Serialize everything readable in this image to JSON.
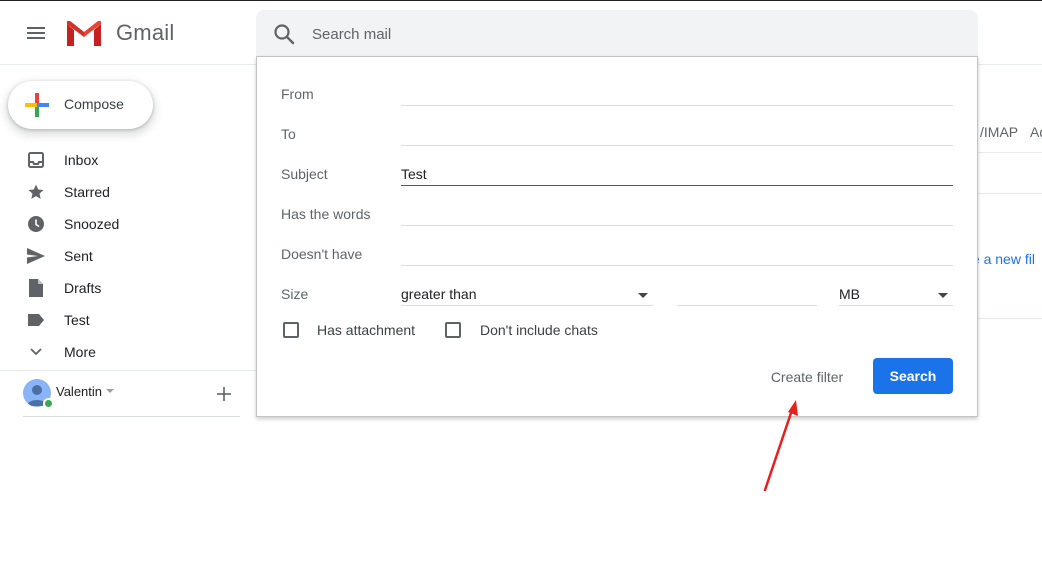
{
  "header": {
    "app_name": "Gmail",
    "search_placeholder": "Search mail",
    "icons": {
      "menu": "hamburger-menu-icon",
      "logo": "gmail-logo-icon",
      "search": "search-icon"
    }
  },
  "sidebar": {
    "compose_label": "Compose",
    "items": [
      {
        "label": "Inbox",
        "icon": "inbox-icon"
      },
      {
        "label": "Starred",
        "icon": "star-icon"
      },
      {
        "label": "Snoozed",
        "icon": "clock-icon"
      },
      {
        "label": "Sent",
        "icon": "send-icon"
      },
      {
        "label": "Drafts",
        "icon": "draft-icon"
      },
      {
        "label": "Test",
        "icon": "label-icon"
      },
      {
        "label": "More",
        "icon": "chevron-down-icon"
      }
    ],
    "user": {
      "name": "Valentin",
      "status": "online"
    }
  },
  "background": {
    "tab_imap": "/IMAP",
    "tab_partial": "Ad",
    "link_partial": "te a new fil"
  },
  "advanced_search": {
    "from": {
      "label": "From",
      "value": ""
    },
    "to": {
      "label": "To",
      "value": ""
    },
    "subject": {
      "label": "Subject",
      "value": "Test"
    },
    "has_words": {
      "label": "Has the words",
      "value": ""
    },
    "doesnt_have": {
      "label": "Doesn't have",
      "value": ""
    },
    "size": {
      "label": "Size",
      "operator": "greater than",
      "amount": "",
      "unit": "MB"
    },
    "has_attachment": {
      "label": "Has attachment",
      "checked": false
    },
    "dont_include_chats": {
      "label": "Don't include chats",
      "checked": false
    },
    "create_filter_label": "Create filter",
    "search_label": "Search"
  },
  "annotation": {
    "arrow_color": "#e8201c"
  },
  "colors": {
    "primary": "#1a73e8",
    "active_underline": "#188038"
  }
}
